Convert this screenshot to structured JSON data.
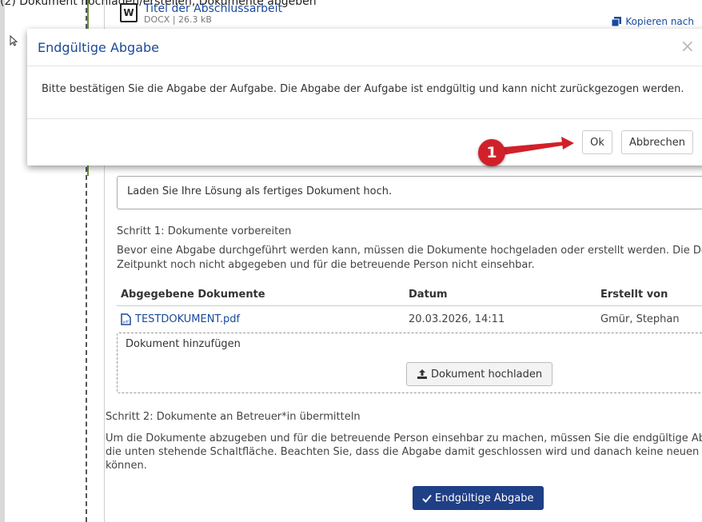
{
  "top_caption": "(2) Dokument hochladen/erstellen, Dokumente abgeben",
  "attachment": {
    "title": "Titel der Abschlussarbeit",
    "meta": "DOCX | 26.3 kB",
    "copy_label": "Kopieren nach"
  },
  "info_text": "Laden Sie Ihre Lösung als fertiges Dokument hoch.",
  "step1": {
    "title": "Schritt 1: Dokumente vorbereiten",
    "desc_line1": "Bevor eine Abgabe durchgeführt werden kann, müssen die Dokumente hochgeladen oder erstellt werden. Die Dokumen",
    "desc_line2": "Zeitpunkt noch nicht abgegeben und für die betreuende Person nicht einsehbar."
  },
  "documents_table": {
    "headers": [
      "Abgegebene Dokumente",
      "Datum",
      "Erstellt von"
    ],
    "rows": [
      {
        "name": "TESTDOKUMENT.pdf",
        "date": "20.03.2026, 14:11",
        "author": "Gmür, Stephan"
      }
    ]
  },
  "dropzone": {
    "label": "Dokument hinzufügen",
    "upload_label": "Dokument hochladen"
  },
  "step2": {
    "title": "Schritt 2: Dokumente an Betreuer*in übermitteln",
    "desc_line1": "Um die Dokumente abzugeben und für die betreuende Person einsehbar zu machen, müssen Sie die endgültige Abgabe",
    "desc_line2": "die unten stehende Schaltfläche. Beachten Sie, dass die Abgabe damit geschlossen wird und danach keine neuen Doku",
    "desc_line3": "können."
  },
  "final_submit_label": "Endgültige Abgabe",
  "modal": {
    "title": "Endgültige Abgabe",
    "close_symbol": "×",
    "body": "Bitte bestätigen Sie die Abgabe der Aufgabe. Die Abgabe der Aufgabe ist endgültig und kann nicht zurückgezogen werden.",
    "ok_label": "Ok",
    "cancel_label": "Abbrechen"
  },
  "annotation": {
    "number": "1",
    "color": "#d2202a"
  },
  "colors": {
    "link": "#1a4a9c",
    "primary": "#1f3f86"
  }
}
